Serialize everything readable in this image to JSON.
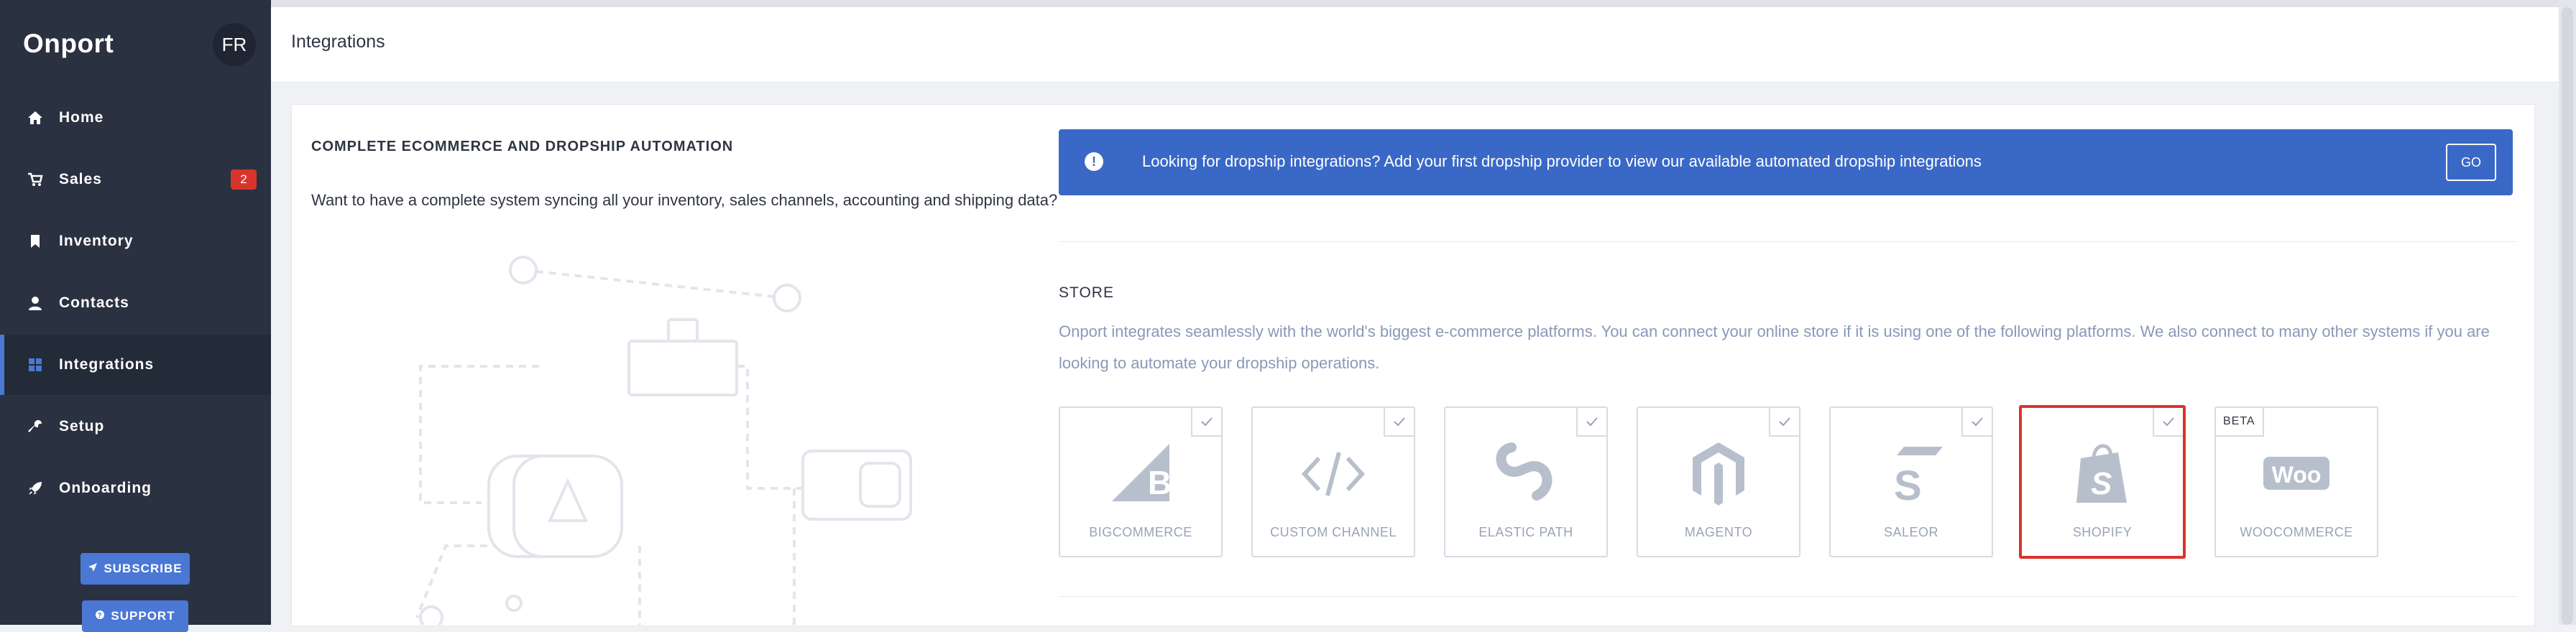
{
  "app": {
    "brand": "Onport",
    "user_initials": "FR"
  },
  "sidebar": {
    "items": [
      {
        "label": "Home",
        "icon": "home-icon"
      },
      {
        "label": "Sales",
        "icon": "cart-icon",
        "badge": "2"
      },
      {
        "label": "Inventory",
        "icon": "bookmark-icon"
      },
      {
        "label": "Contacts",
        "icon": "user-icon"
      },
      {
        "label": "Integrations",
        "icon": "grid-icon",
        "active": true
      },
      {
        "label": "Setup",
        "icon": "wrench-icon"
      },
      {
        "label": "Onboarding",
        "icon": "rocket-icon"
      }
    ],
    "subscribe_label": "SUBSCRIBE",
    "support_label": "SUPPORT"
  },
  "header": {
    "title": "Integrations"
  },
  "left": {
    "heading": "COMPLETE ECOMMERCE AND DROPSHIP AUTOMATION",
    "text": "Want to have a complete system syncing all your inventory, sales channels, accounting and shipping data?"
  },
  "banner": {
    "text": "Looking for dropship integrations? Add your first dropship provider to view our available automated dropship integrations",
    "button": "GO"
  },
  "store": {
    "title": "STORE",
    "description": "Onport integrates seamlessly with the world's biggest e-commerce platforms. You can connect your online store if it is using one of the following platforms. We also connect to many other systems if you are looking to automate your dropship operations.",
    "platforms": [
      {
        "label": "BIGCOMMERCE",
        "icon": "bigcommerce-icon"
      },
      {
        "label": "CUSTOM CHANNEL",
        "icon": "code-icon"
      },
      {
        "label": "ELASTIC PATH",
        "icon": "elastic-path-icon"
      },
      {
        "label": "MAGENTO",
        "icon": "magento-icon"
      },
      {
        "label": "SALEOR",
        "icon": "saleor-icon"
      },
      {
        "label": "SHOPIFY",
        "icon": "shopify-icon",
        "selected": true
      },
      {
        "label": "WOOCOMMERCE",
        "icon": "woocommerce-icon",
        "badge": "BETA"
      }
    ]
  },
  "colors": {
    "sidebar": "#2a3140",
    "accent": "#3a68c6",
    "badge": "#d9342b",
    "selected_border": "#d9342b"
  }
}
